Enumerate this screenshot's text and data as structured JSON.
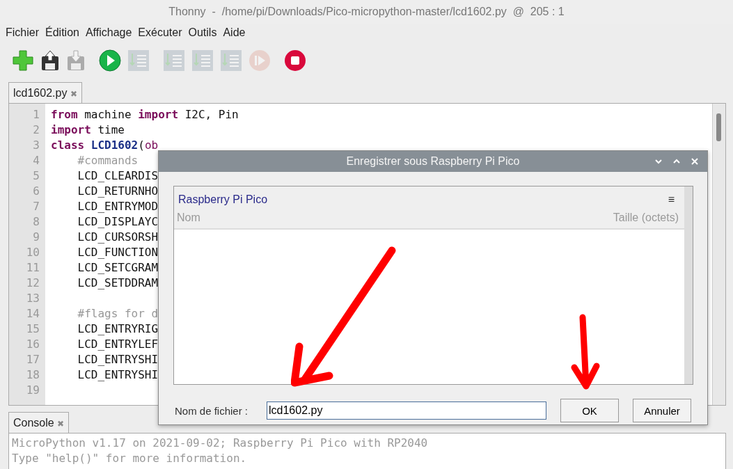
{
  "window": {
    "title": "Thonny  -  /home/pi/Downloads/Pico-micropython-master/lcd1602.py  @  205 : 1"
  },
  "menu": [
    "Fichier",
    "Édition",
    "Affichage",
    "Exécuter",
    "Outils",
    "Aide"
  ],
  "toolbar": [
    {
      "kind": "new",
      "disabled": false
    },
    {
      "kind": "save",
      "disabled": false
    },
    {
      "kind": "download",
      "disabled": true
    },
    {
      "kind": "run",
      "disabled": false
    },
    {
      "kind": "debug",
      "disabled": true
    },
    {
      "kind": "step",
      "disabled": true
    },
    {
      "kind": "stepin",
      "disabled": true
    },
    {
      "kind": "stepout",
      "disabled": true
    },
    {
      "kind": "resume",
      "disabled": true
    },
    {
      "kind": "stop",
      "disabled": false
    }
  ],
  "editor_tabs": [
    {
      "label": "lcd1602.py",
      "close": "✖",
      "selected": true
    }
  ],
  "code": [
    {
      "n": "1",
      "tokens": [
        {
          "kind": "keyword",
          "t": "from"
        },
        {
          "kind": "plain",
          "t": " machine "
        },
        {
          "kind": "keyword",
          "t": "import"
        },
        {
          "kind": "plain",
          "t": " I2C, Pin"
        }
      ]
    },
    {
      "n": "2",
      "tokens": [
        {
          "kind": "keyword",
          "t": "import"
        },
        {
          "kind": "plain",
          "t": " time"
        }
      ]
    },
    {
      "n": "3",
      "tokens": [
        {
          "kind": "keyword",
          "t": "class"
        },
        {
          "kind": "classname",
          "t": " LCD1602"
        },
        {
          "kind": "plain",
          "t": "("
        },
        {
          "kind": "builtin",
          "t": "ob"
        }
      ]
    },
    {
      "n": "4",
      "tokens": [
        {
          "kind": "comment",
          "t": "    #commands"
        }
      ]
    },
    {
      "n": "5",
      "tokens": [
        {
          "kind": "plain",
          "t": "    LCD_CLEARDIS"
        }
      ]
    },
    {
      "n": "6",
      "tokens": [
        {
          "kind": "plain",
          "t": "    LCD_RETURNHO"
        }
      ]
    },
    {
      "n": "7",
      "tokens": [
        {
          "kind": "plain",
          "t": "    LCD_ENTRYMOD"
        }
      ]
    },
    {
      "n": "8",
      "tokens": [
        {
          "kind": "plain",
          "t": "    LCD_DISPLAYC"
        }
      ]
    },
    {
      "n": "9",
      "tokens": [
        {
          "kind": "plain",
          "t": "    LCD_CURSORSH"
        }
      ]
    },
    {
      "n": "10",
      "tokens": [
        {
          "kind": "plain",
          "t": "    LCD_FUNCTION"
        }
      ]
    },
    {
      "n": "11",
      "tokens": [
        {
          "kind": "plain",
          "t": "    LCD_SETCGRAM"
        }
      ]
    },
    {
      "n": "12",
      "tokens": [
        {
          "kind": "plain",
          "t": "    LCD_SETDDRAM"
        }
      ]
    },
    {
      "n": "13"
    },
    {
      "n": "14",
      "tokens": [
        {
          "kind": "comment",
          "t": "    #flags for d"
        }
      ]
    },
    {
      "n": "15",
      "tokens": [
        {
          "kind": "plain",
          "t": "    LCD_ENTRYRIG"
        }
      ]
    },
    {
      "n": "16",
      "tokens": [
        {
          "kind": "plain",
          "t": "    LCD_ENTRYLEF"
        }
      ]
    },
    {
      "n": "17",
      "tokens": [
        {
          "kind": "plain",
          "t": "    LCD_ENTRYSHI"
        }
      ]
    },
    {
      "n": "18",
      "tokens": [
        {
          "kind": "plain",
          "t": "    LCD_ENTRYSHI"
        }
      ]
    },
    {
      "n": "19"
    }
  ],
  "console": {
    "tab": {
      "label": "Console",
      "close": "✖",
      "selected": true
    },
    "lines": [
      "MicroPython v1.17 on 2021-09-02; Raspberry Pi Pico with RP2040",
      "Type \"help()\" for more information."
    ]
  },
  "dialog": {
    "title": "Enregistrer sous Raspberry Pi Pico",
    "location": "Raspberry Pi Pico",
    "menu_glyph": "≡",
    "columns": [
      "Nom",
      "Taille (octets)"
    ],
    "filename_label": "Nom de fichier :",
    "filename": "lcd1602.py",
    "buttons": [
      "OK",
      "Annuler"
    ]
  }
}
